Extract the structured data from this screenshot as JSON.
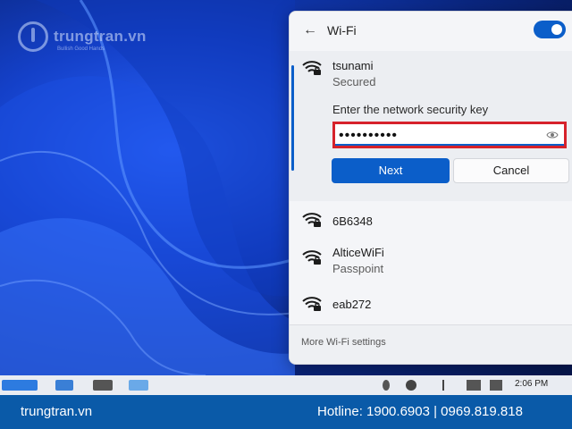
{
  "watermark": {
    "brand": "trungtran.vn",
    "tagline": "Bullish Good Hands"
  },
  "wifi_panel": {
    "title": "Wi-Fi",
    "toggle_on": true,
    "accent_color": "#0b5ec9",
    "expanded_network": {
      "name": "tsunami",
      "status": "Secured",
      "key_label": "Enter the network security key",
      "key_value": "••••••••••",
      "next_label": "Next",
      "cancel_label": "Cancel"
    },
    "networks": [
      {
        "name": "6B6348",
        "status": ""
      },
      {
        "name": "AlticeWiFi",
        "status": "Passpoint"
      },
      {
        "name": "eab272",
        "status": ""
      }
    ],
    "footer_link": "More Wi-Fi settings"
  },
  "taskbar": {
    "time": "2:06 PM"
  },
  "banner": {
    "site": "trungtran.vn",
    "hotline": "Hotline: 1900.6903  |  0969.819.818"
  }
}
